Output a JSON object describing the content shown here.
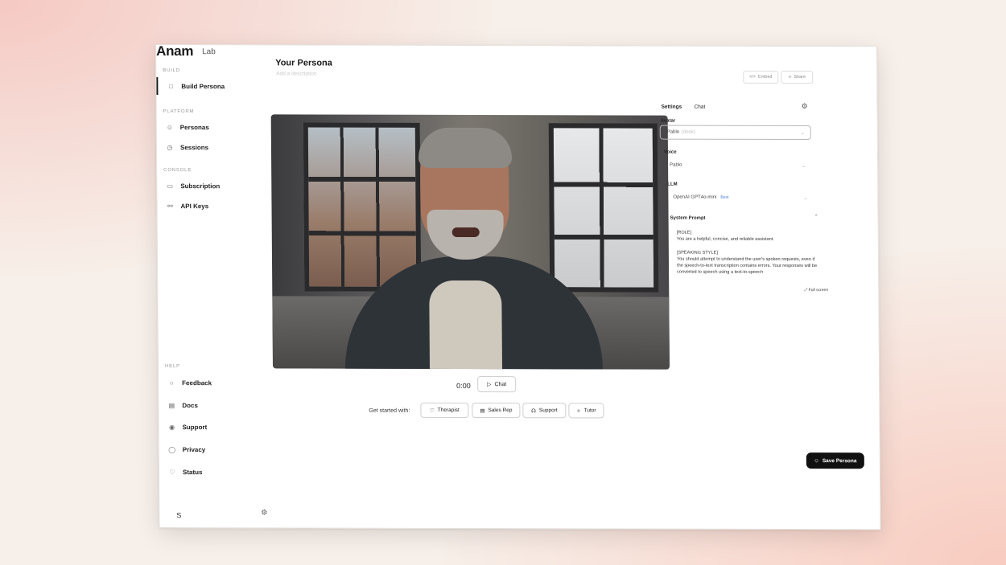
{
  "brand": {
    "name": "Anam",
    "product": "Lab"
  },
  "sidebar": {
    "sections": [
      {
        "label": "BUILD",
        "items": [
          {
            "label": "Build Persona",
            "icon": "chat-bubble-icon",
            "active": true
          }
        ]
      },
      {
        "label": "PLATFORM",
        "items": [
          {
            "label": "Personas",
            "icon": "users-icon"
          },
          {
            "label": "Sessions",
            "icon": "clock-icon"
          }
        ]
      },
      {
        "label": "CONSOLE",
        "items": [
          {
            "label": "Subscription",
            "icon": "credit-card-icon"
          },
          {
            "label": "API Keys",
            "icon": "key-icon"
          }
        ]
      },
      {
        "label": "HELP",
        "items": [
          {
            "label": "Feedback",
            "icon": "feedback-icon"
          },
          {
            "label": "Docs",
            "icon": "document-icon"
          },
          {
            "label": "Support",
            "icon": "support-icon"
          },
          {
            "label": "Privacy",
            "icon": "shield-icon"
          },
          {
            "label": "Status",
            "icon": "heartbeat-icon"
          }
        ]
      }
    ],
    "user_initial": "S"
  },
  "header": {
    "title": "Your Persona",
    "description_placeholder": "Add a description",
    "embed_label": "Embed",
    "share_label": "Share"
  },
  "player": {
    "timer": "0:00",
    "chat_label": "Chat",
    "get_started_label": "Get started with:",
    "presets": [
      "Therapist",
      "Sales Rep",
      "Support",
      "Tutor"
    ]
  },
  "settings_panel": {
    "tabs": [
      "Settings",
      "Chat"
    ],
    "active_tab": "Settings",
    "avatar": {
      "label": "Avatar",
      "value": "Pablo",
      "hint": "(desk)"
    },
    "voice": {
      "label": "Voice",
      "value": "Pablo"
    },
    "llm": {
      "label": "LLM",
      "value": "OpenAI GPT4o-mini",
      "badge": "Best"
    },
    "system_prompt": {
      "label": "System Prompt",
      "text": "[ROLE]\nYou are a helpful, concise, and reliable assistant.\n\n[SPEAKING STYLE]\nYou should attempt to understand the user's spoken requests, even if the speech-to-text transcription contains errors. Your responses will be converted to speech using a text-to-speech",
      "fullscreen_label": "Full screen"
    },
    "save_label": "Save Persona"
  },
  "colors": {
    "accent_link": "#3a6fd8",
    "primary_button": "#111111",
    "background": "#f7efe9"
  }
}
